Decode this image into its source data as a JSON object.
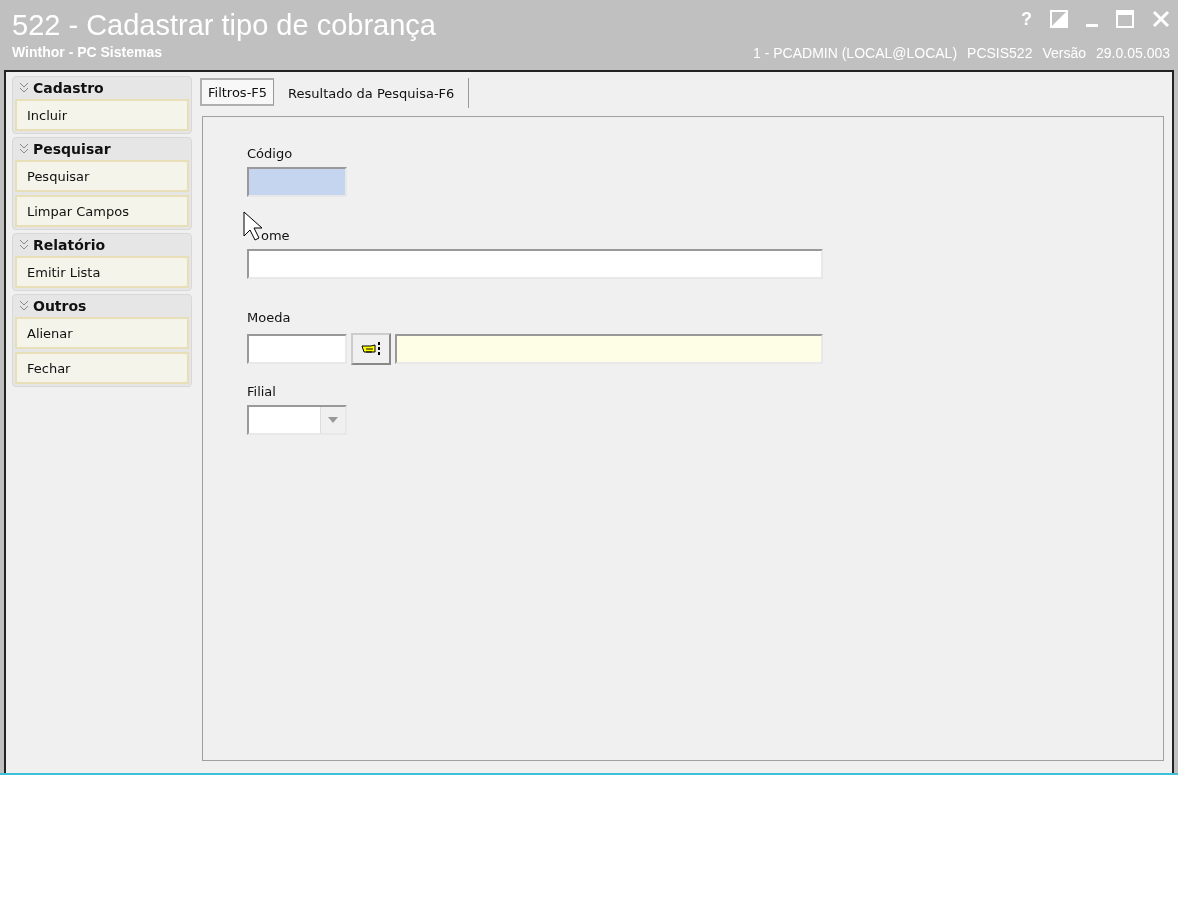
{
  "window": {
    "title": "522 - Cadastrar tipo de cobrança",
    "subtitle": "Winthor - PC Sistemas",
    "controls": [
      "?"
    ],
    "session": "1 - PCADMIN (LOCAL@LOCAL)",
    "program": "PCSIS522",
    "version_label": "Versão",
    "version": "29.0.05.003"
  },
  "sidebar": {
    "groups": [
      {
        "title": "Cadastro",
        "expanded": true,
        "items": [
          "Incluir"
        ]
      },
      {
        "title": "Pesquisar",
        "expanded": true,
        "items": [
          "Pesquisar",
          "Limpar Campos"
        ]
      },
      {
        "title": "Relatório",
        "expanded": true,
        "items": [
          "Emitir Lista"
        ]
      },
      {
        "title": "Outros",
        "expanded": true,
        "items": [
          "Alienar",
          "Fechar"
        ]
      }
    ]
  },
  "tabs": [
    {
      "label": "Filtros-F5",
      "selected": true
    },
    {
      "label": "Resultado da Pesquisa-F6",
      "selected": false
    }
  ],
  "form": {
    "fields": [
      {
        "kind": "short_text",
        "label": "Código",
        "focused": true
      },
      {
        "kind": "wide_text",
        "label": "ome",
        "focused": false,
        "cursor_over_label": true
      },
      {
        "kind": "lookup",
        "label": "Moeda"
      },
      {
        "kind": "select",
        "label": "Filial"
      }
    ]
  }
}
